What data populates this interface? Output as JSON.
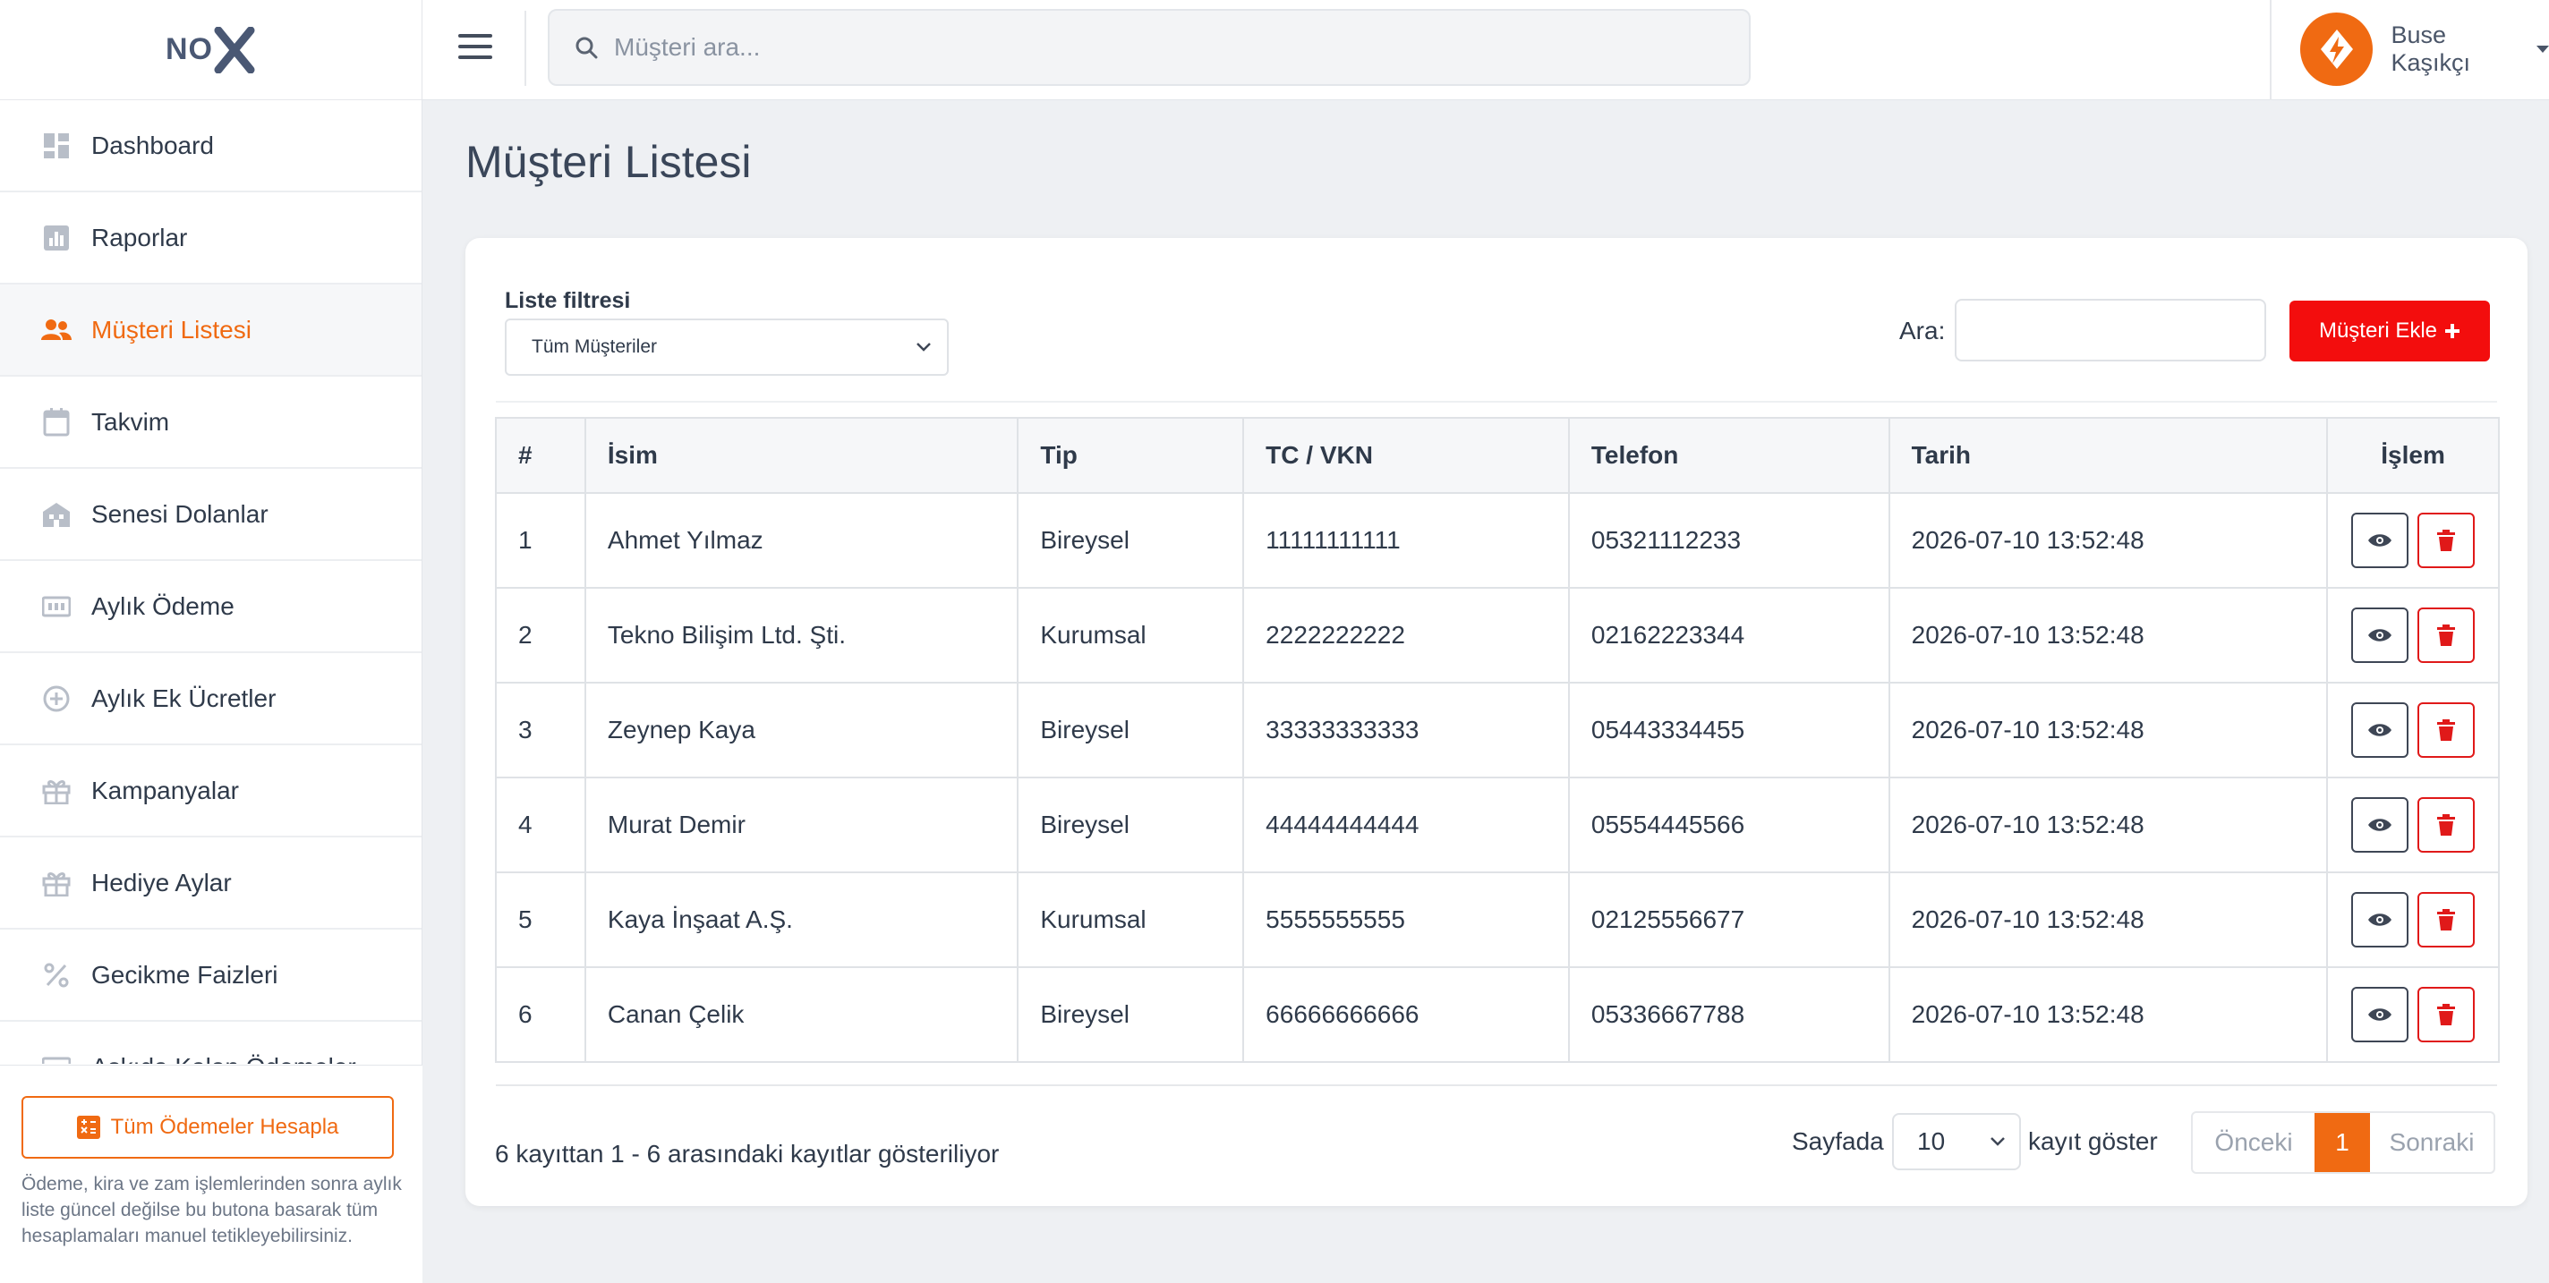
{
  "brand": {
    "logo_text": "NO"
  },
  "sidebar": {
    "items": [
      {
        "label": "Dashboard",
        "icon": "dashboard-icon"
      },
      {
        "label": "Raporlar",
        "icon": "bar-chart-icon"
      },
      {
        "label": "Müşteri Listesi",
        "icon": "users-icon",
        "active": true
      },
      {
        "label": "Takvim",
        "icon": "calendar-icon"
      },
      {
        "label": "Senesi Dolanlar",
        "icon": "building-icon"
      },
      {
        "label": "Aylık Ödeme",
        "icon": "bill-icon"
      },
      {
        "label": "Aylık Ek Ücretler",
        "icon": "plus-circle-icon"
      },
      {
        "label": "Kampanyalar",
        "icon": "gift-icon"
      },
      {
        "label": "Hediye Aylar",
        "icon": "gift-icon"
      },
      {
        "label": "Gecikme Faizleri",
        "icon": "percent-icon"
      },
      {
        "label": "Askıda Kalan Ödemeler",
        "icon": "bill-icon"
      }
    ],
    "footer": {
      "button_label": "Tüm Ödemeler Hesapla",
      "note": "Ödeme, kira ve zam işlemlerinden sonra aylık liste güncel değilse bu butona basarak tüm hesaplamaları manuel tetikleyebilirsiniz."
    }
  },
  "topbar": {
    "search_placeholder": "Müşteri ara...",
    "user_name": "Buse Kaşıkçı"
  },
  "page": {
    "title": "Müşteri Listesi"
  },
  "filters": {
    "label": "Liste filtresi",
    "selected": "Tüm Müşteriler",
    "search_label": "Ara:",
    "add_button": "Müşteri Ekle"
  },
  "table": {
    "headers": [
      "#",
      "İsim",
      "Tip",
      "TC / VKN",
      "Telefon",
      "Tarih",
      "İşlem"
    ],
    "rows": [
      [
        "1",
        "Ahmet Yılmaz",
        "Bireysel",
        "11111111111",
        "05321112233",
        "2026-07-10 13:52:48"
      ],
      [
        "2",
        "Tekno Bilişim Ltd. Şti.",
        "Kurumsal",
        "2222222222",
        "02162223344",
        "2026-07-10 13:52:48"
      ],
      [
        "3",
        "Zeynep Kaya",
        "Bireysel",
        "33333333333",
        "05443334455",
        "2026-07-10 13:52:48"
      ],
      [
        "4",
        "Murat Demir",
        "Bireysel",
        "44444444444",
        "05554445566",
        "2026-07-10 13:52:48"
      ],
      [
        "5",
        "Kaya İnşaat A.Ş.",
        "Kurumsal",
        "5555555555",
        "02125556677",
        "2026-07-10 13:52:48"
      ],
      [
        "6",
        "Canan Çelik",
        "Bireysel",
        "66666666666",
        "05336667788",
        "2026-07-10 13:52:48"
      ]
    ]
  },
  "footer": {
    "info": "6 kayıttan 1 - 6 arasındaki kayıtlar gösteriliyor",
    "length_prefix": "Sayfada",
    "length_value": "10",
    "length_suffix": "kayıt göster",
    "prev": "Önceki",
    "page": "1",
    "next": "Sonraki"
  },
  "colors": {
    "accent": "#f06a12",
    "danger": "#f30d0d",
    "text": "#2f3a4a"
  }
}
